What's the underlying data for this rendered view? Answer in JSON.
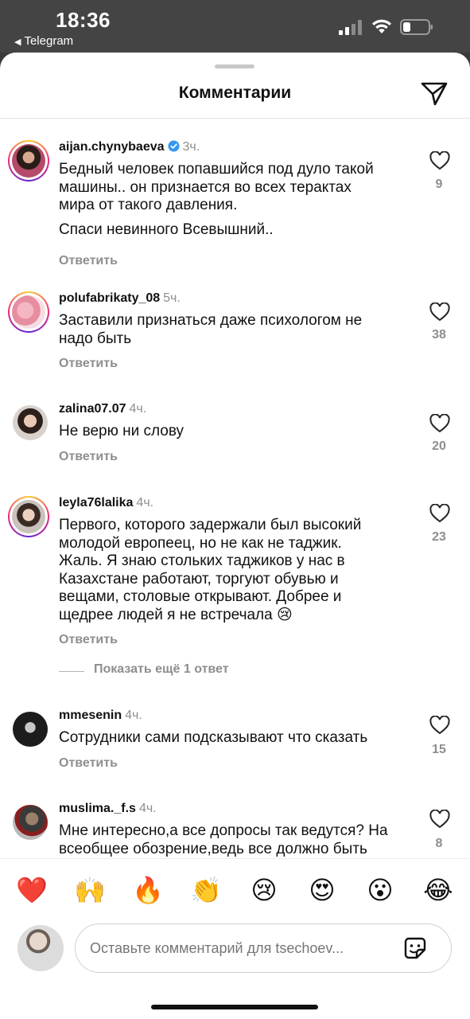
{
  "status_bar": {
    "time": "18:36",
    "back_app": "Telegram"
  },
  "header": {
    "title": "Комментарии"
  },
  "comments": [
    {
      "username": "aijan.chynybaeva",
      "verified": true,
      "time": "3ч.",
      "text_lines": [
        "Бедный человек попавшийся под дуло такой",
        "машины.. он признается во всех терактах",
        "мира от такого давления."
      ],
      "text_extra": "Спаси невинного Всевышний..",
      "reply_label": "Ответить",
      "likes": "9"
    },
    {
      "username": "polufabrikaty_08",
      "time": "5ч.",
      "text_lines": [
        "Заставили признаться даже психологом не",
        "надо быть"
      ],
      "reply_label": "Ответить",
      "likes": "38"
    },
    {
      "username": "zalina07.07",
      "time": "4ч.",
      "text_lines": [
        "Не верю ни слову"
      ],
      "reply_label": "Ответить",
      "likes": "20"
    },
    {
      "username": "leyla76lalika",
      "time": "4ч.",
      "text_lines": [
        "Первого, которого задержали был высокий",
        "молодой европеец, но не как не таджик.",
        "Жаль. Я знаю стольких таджиков у нас в",
        "Казахстане работают, торгуют обувью и",
        "вещами, столовые открывают. Добрее и",
        "щедрее людей я не встречала 😢"
      ],
      "reply_label": "Ответить",
      "likes": "23",
      "more_replies": "Показать ещё 1 ответ"
    },
    {
      "username": "mmesenin",
      "time": "4ч.",
      "text_lines": [
        "Сотрудники сами подсказывают что сказать"
      ],
      "reply_label": "Ответить",
      "likes": "15"
    },
    {
      "username": "muslima._f.s",
      "time": "4ч.",
      "text_lines": [
        "Мне интересно,а все допросы так ведутся? На",
        "всеобщее обозрение,ведь все должно быть"
      ],
      "likes": "8"
    }
  ],
  "emoji_bar": [
    "❤️",
    "🙌",
    "🔥",
    "👏",
    "😢",
    "😍",
    "😮",
    "😂"
  ],
  "input": {
    "placeholder": "Оставьте комментарий для tsechoev..."
  },
  "colors": {
    "sheet_bg": "#ffffff",
    "status_bar_bg": "#444444",
    "muted_text": "#8e8e8e",
    "verified_blue": "#3897f0",
    "like_icon": "#262626"
  },
  "icons": [
    "share-icon",
    "heart-outline-icon",
    "verified-icon",
    "sticker-icon",
    "signal-icon",
    "wifi-icon",
    "battery-icon"
  ]
}
